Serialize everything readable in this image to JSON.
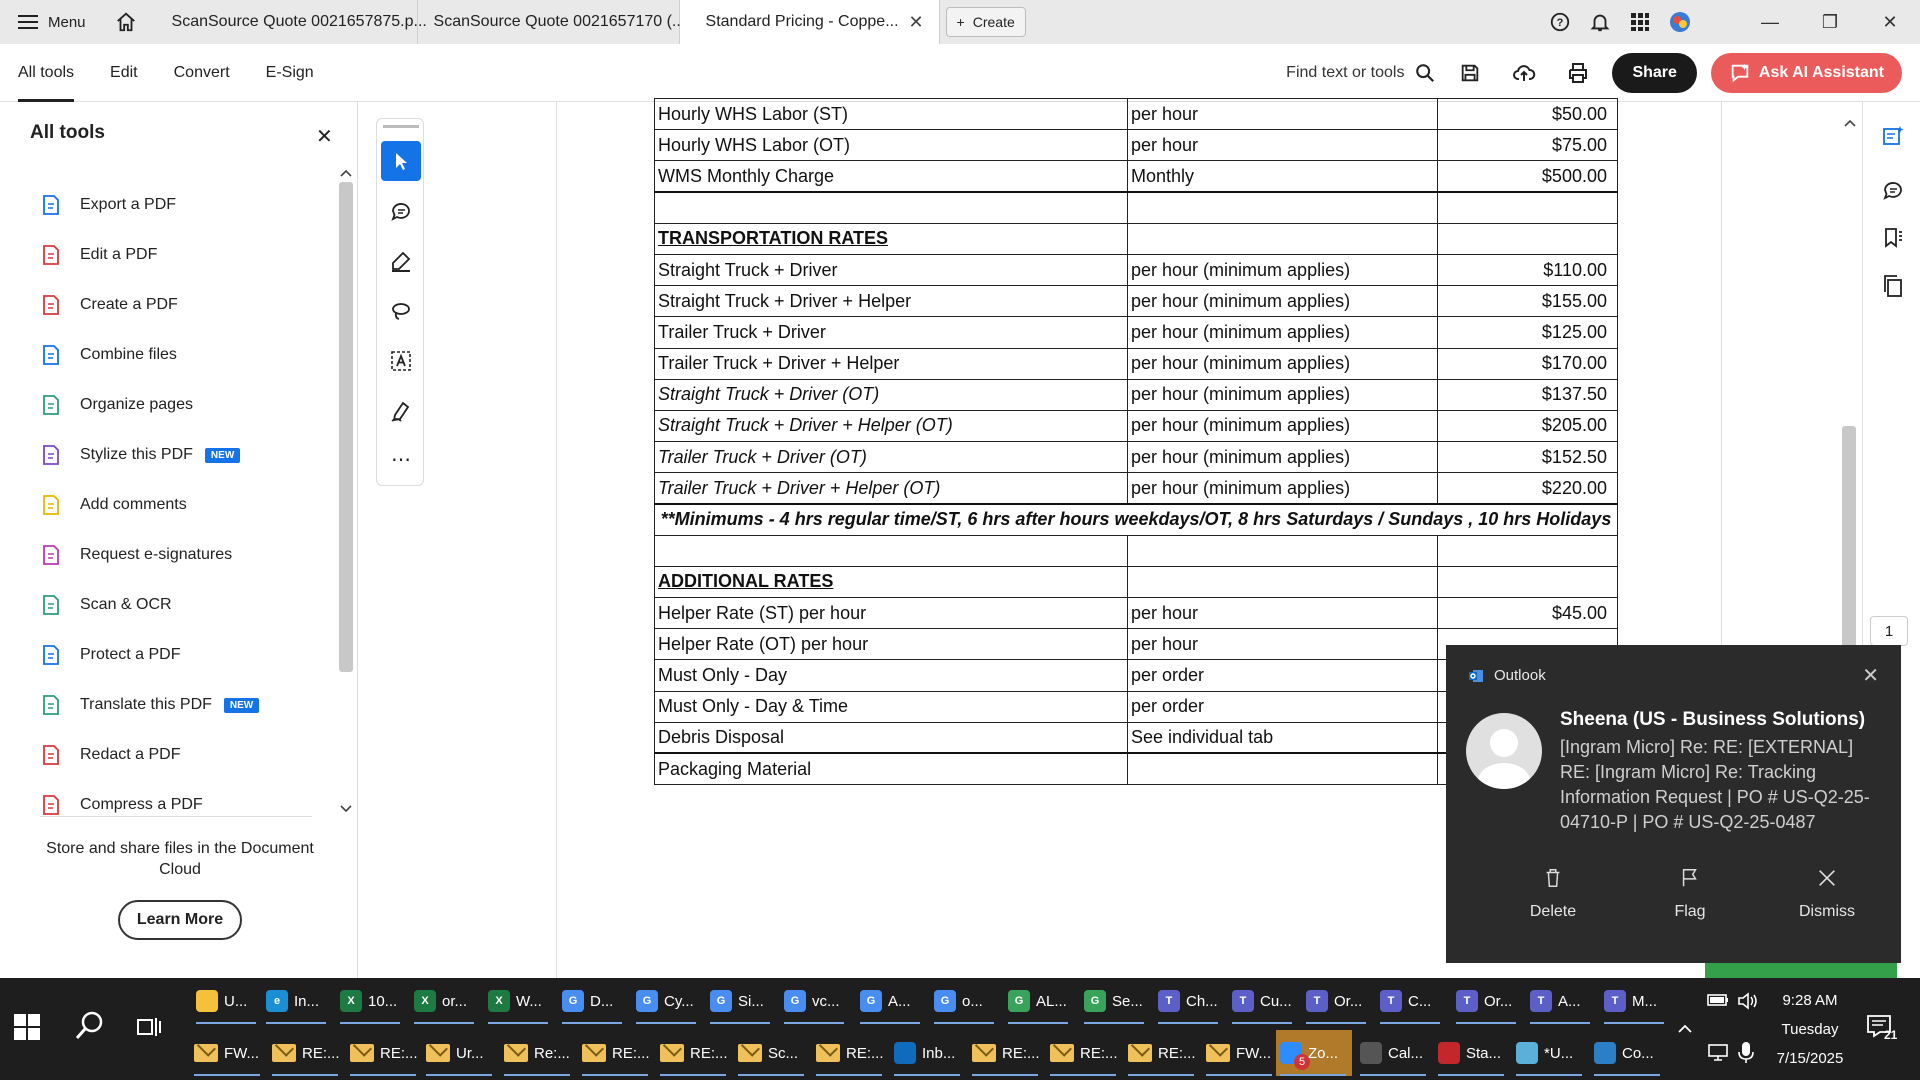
{
  "tabbar": {
    "menu_label": "Menu",
    "tabs": [
      {
        "label": "ScanSource Quote 0021657875.p..."
      },
      {
        "label": "ScanSource Quote 0021657170 (..."
      },
      {
        "label": "Standard Pricing - Coppe..."
      }
    ],
    "create_label": "Create"
  },
  "toolbar": {
    "nav": [
      "All tools",
      "Edit",
      "Convert",
      "E-Sign"
    ],
    "find_label": "Find text or tools",
    "share_label": "Share",
    "ai_label": "Ask AI Assistant"
  },
  "leftpanel": {
    "title": "All tools",
    "items": [
      {
        "label": "Export a PDF",
        "icon": "export-pdf-icon",
        "color": "#1473e6"
      },
      {
        "label": "Edit a PDF",
        "icon": "edit-pdf-icon",
        "color": "#d7373f"
      },
      {
        "label": "Create a PDF",
        "icon": "create-pdf-icon",
        "color": "#d7373f"
      },
      {
        "label": "Combine files",
        "icon": "combine-files-icon",
        "color": "#1473e6"
      },
      {
        "label": "Organize pages",
        "icon": "organize-pages-icon",
        "color": "#2d9d78"
      },
      {
        "label": "Stylize this PDF",
        "icon": "stylize-pdf-icon",
        "color": "#7a47c9",
        "badge": "NEW"
      },
      {
        "label": "Add comments",
        "icon": "add-comments-icon",
        "color": "#e6b800"
      },
      {
        "label": "Request e-signatures",
        "icon": "request-esignatures-icon",
        "color": "#b93bb3"
      },
      {
        "label": "Scan & OCR",
        "icon": "scan-ocr-icon",
        "color": "#2d9d78"
      },
      {
        "label": "Protect a PDF",
        "icon": "protect-pdf-icon",
        "color": "#1473e6"
      },
      {
        "label": "Translate this PDF",
        "icon": "translate-pdf-icon",
        "color": "#2d9d78",
        "badge": "NEW"
      },
      {
        "label": "Redact a PDF",
        "icon": "redact-pdf-icon",
        "color": "#d7373f"
      },
      {
        "label": "Compress a PDF",
        "icon": "compress-pdf-icon",
        "color": "#d7373f"
      }
    ],
    "cloud_text": "Store and share files in the Document Cloud",
    "learn_more": "Learn More"
  },
  "document": {
    "rows": [
      {
        "c1": "Hourly WHS Labor (ST)",
        "c2": "per hour",
        "c3": "$50.00"
      },
      {
        "c1": "Hourly WHS Labor (OT)",
        "c2": "per hour",
        "c3": "$75.00"
      },
      {
        "c1": "WMS Monthly Charge",
        "c2": "Monthly",
        "c3": "$500.00"
      },
      {
        "c1": "",
        "c2": "",
        "c3": ""
      },
      {
        "c1": "TRANSPORTATION RATES",
        "c2": "",
        "c3": "",
        "header": true
      },
      {
        "c1": "Straight Truck + Driver",
        "c2": "per hour (minimum applies)",
        "c3": "$110.00"
      },
      {
        "c1": "Straight Truck + Driver + Helper",
        "c2": "per hour (minimum applies)",
        "c3": "$155.00"
      },
      {
        "c1": "Trailer Truck + Driver",
        "c2": "per hour (minimum applies)",
        "c3": "$125.00"
      },
      {
        "c1": "Trailer Truck + Driver + Helper",
        "c2": "per hour (minimum applies)",
        "c3": "$170.00"
      },
      {
        "c1": "Straight Truck + Driver (OT)",
        "c2": "per hour (minimum applies)",
        "c3": "$137.50",
        "italic": true
      },
      {
        "c1": "Straight Truck + Driver + Helper (OT)",
        "c2": "per hour (minimum applies)",
        "c3": "$205.00",
        "italic": true
      },
      {
        "c1": "Trailer Truck + Driver (OT)",
        "c2": "per hour (minimum applies)",
        "c3": "$152.50",
        "italic": true
      },
      {
        "c1": "Trailer Truck + Driver + Helper (OT)",
        "c2": "per hour (minimum applies)",
        "c3": "$220.00",
        "italic": true
      }
    ],
    "note": "**Minimums -  4 hrs regular time/ST, 6 hrs after hours weekdays/OT, 8 hrs Saturdays / Sundays , 10 hrs Holidays",
    "rows2": [
      {
        "c1": "",
        "c2": "",
        "c3": ""
      },
      {
        "c1": "ADDITIONAL RATES",
        "c2": "",
        "c3": "",
        "header": true
      },
      {
        "c1": "Helper Rate (ST) per hour",
        "c2": "per hour",
        "c3": "$45.00"
      },
      {
        "c1": "Helper Rate (OT) per hour",
        "c2": "per hour",
        "c3": ""
      },
      {
        "c1": "Must Only - Day",
        "c2": "per order",
        "c3": ""
      },
      {
        "c1": "Must Only - Day & Time",
        "c2": "per order",
        "c3": ""
      },
      {
        "c1": "Debris Disposal",
        "c2": "See individual tab",
        "c3": ""
      },
      {
        "c1": "Packaging Material",
        "c2": "",
        "c3": ""
      }
    ],
    "page_number": "1"
  },
  "toast": {
    "app": "Outlook",
    "sender": "Sheena (US - Business Solutions)",
    "body": "[Ingram Micro] Re: RE: [EXTERNAL] RE: [Ingram Micro] Re: Tracking Information Request | PO # US-Q2-25-04710-P | PO # US-Q2-25-0487",
    "actions": [
      "Delete",
      "Flag",
      "Dismiss"
    ]
  },
  "taskbar": {
    "row1": [
      {
        "label": "U...",
        "color": "#f3c13a",
        "glyph": ""
      },
      {
        "label": "In...",
        "color": "#1b8fd6",
        "glyph": "e"
      },
      {
        "label": "10...",
        "color": "#1d7a43",
        "glyph": "X"
      },
      {
        "label": "or...",
        "color": "#1d7a43",
        "glyph": "X"
      },
      {
        "label": "W...",
        "color": "#1d7a43",
        "glyph": "X"
      },
      {
        "label": "D...",
        "color": "#4a8df0",
        "glyph": "G"
      },
      {
        "label": "Cy...",
        "color": "#4a8df0",
        "glyph": "G"
      },
      {
        "label": "Si...",
        "color": "#4a8df0",
        "glyph": "G"
      },
      {
        "label": "vc...",
        "color": "#4a8df0",
        "glyph": "G"
      },
      {
        "label": "A...",
        "color": "#4a8df0",
        "glyph": "G"
      },
      {
        "label": "o...",
        "color": "#4a8df0",
        "glyph": "G"
      },
      {
        "label": "AL...",
        "color": "#3aa35b",
        "glyph": "G"
      },
      {
        "label": "Se...",
        "color": "#3aa35b",
        "glyph": "G"
      },
      {
        "label": "Ch...",
        "color": "#5b5fc7",
        "glyph": "T"
      },
      {
        "label": "Cu...",
        "color": "#5b5fc7",
        "glyph": "T"
      },
      {
        "label": "Or...",
        "color": "#5b5fc7",
        "glyph": "T"
      },
      {
        "label": "C...",
        "color": "#5b5fc7",
        "glyph": "T"
      },
      {
        "label": "Or...",
        "color": "#5b5fc7",
        "glyph": "T"
      },
      {
        "label": "A...",
        "color": "#5b5fc7",
        "glyph": "T"
      },
      {
        "label": "M...",
        "color": "#5b5fc7",
        "glyph": "T"
      }
    ],
    "row2": [
      {
        "label": "FW...",
        "type": "mail"
      },
      {
        "label": "RE:...",
        "type": "mail"
      },
      {
        "label": "RE:...",
        "type": "mail"
      },
      {
        "label": "Ur...",
        "type": "mail"
      },
      {
        "label": "Re:...",
        "type": "mail"
      },
      {
        "label": "RE:...",
        "type": "mail"
      },
      {
        "label": "RE:...",
        "type": "mail"
      },
      {
        "label": "Sc...",
        "type": "mail"
      },
      {
        "label": "RE:...",
        "type": "mail"
      },
      {
        "label": "Inb...",
        "type": "outlook"
      },
      {
        "label": "RE:...",
        "type": "mail"
      },
      {
        "label": "RE:...",
        "type": "mail"
      },
      {
        "label": "RE:...",
        "type": "mail"
      },
      {
        "label": "FW...",
        "type": "mail"
      },
      {
        "label": "Zo...",
        "type": "zoom"
      },
      {
        "label": "Cal...",
        "type": "calc"
      },
      {
        "label": "Sta...",
        "type": "acrobat"
      },
      {
        "label": "*U...",
        "type": "notepad"
      },
      {
        "label": "Co...",
        "type": "other"
      }
    ],
    "time": "9:28 AM",
    "day": "Tuesday",
    "date": "7/15/2025",
    "notif_count": "21",
    "zoom_badge": "5"
  }
}
